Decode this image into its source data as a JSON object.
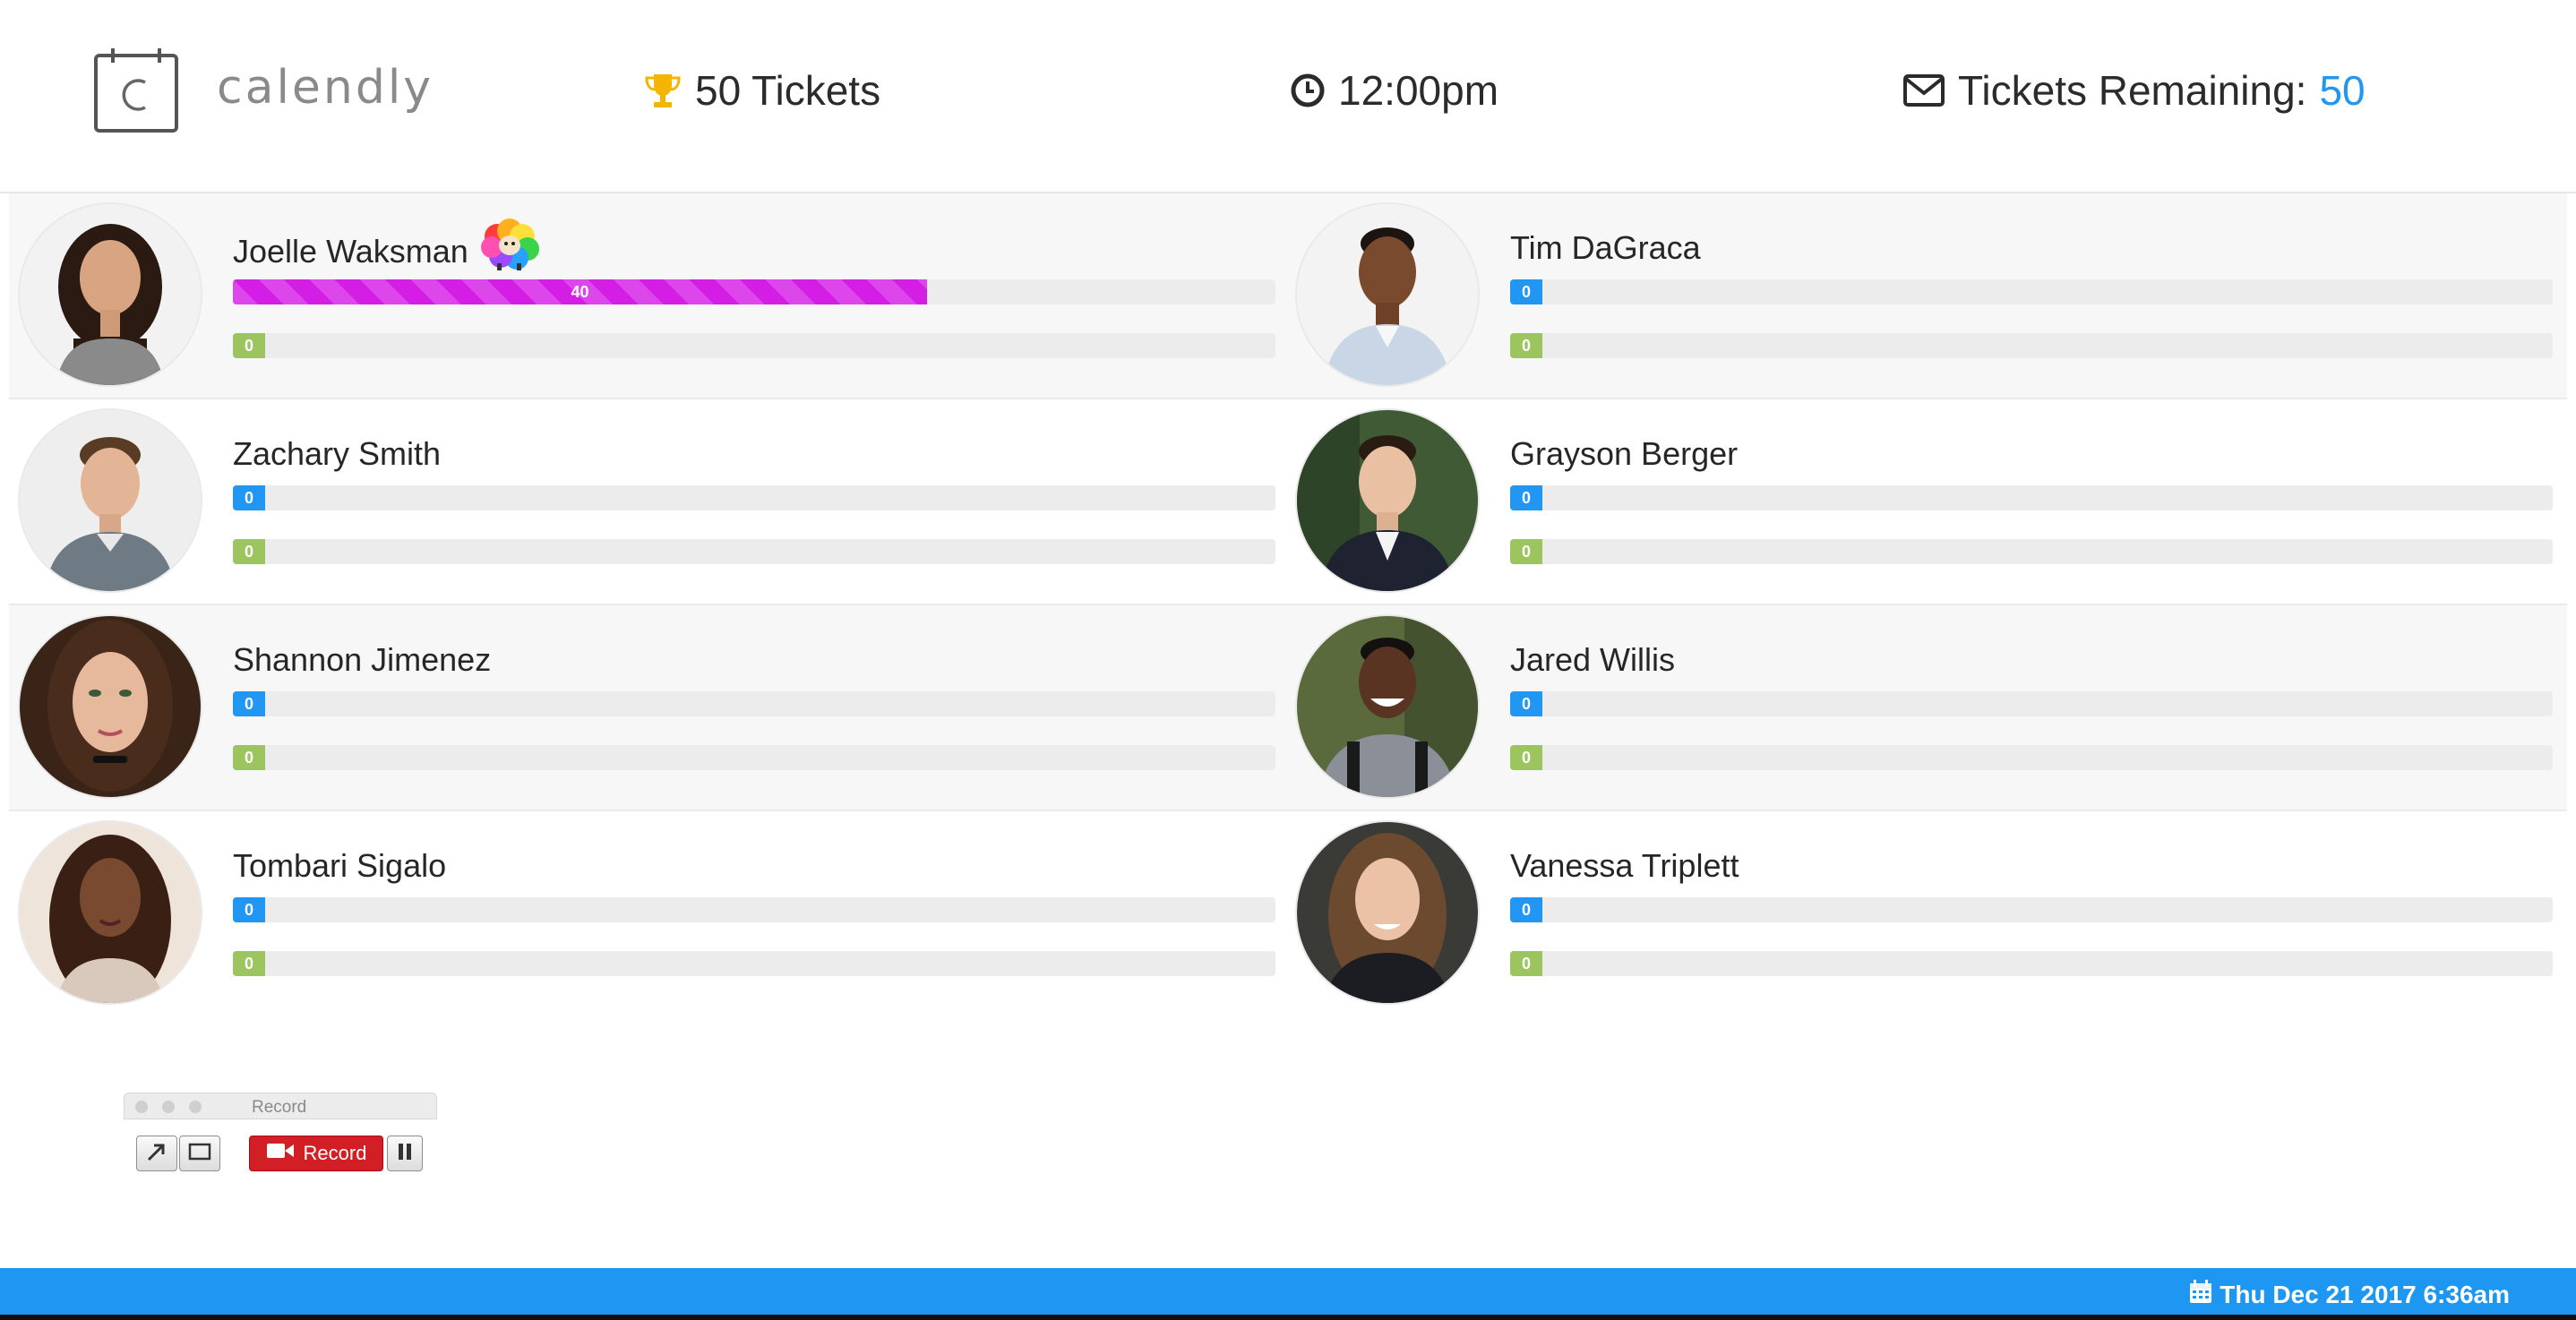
{
  "header": {
    "brand": "calendly",
    "tickets_label": "50 Tickets",
    "time_label": "12:00pm",
    "remaining_label": "Tickets Remaining:",
    "remaining_value": "50",
    "icons": [
      "calendar-logo-icon",
      "trophy-icon",
      "clock-icon",
      "envelope-icon"
    ],
    "colors": {
      "trophy": "#f5b400",
      "remaining": "#2196f3"
    }
  },
  "people": [
    {
      "name": "Joelle Waksman",
      "has_badge": true,
      "primary": {
        "label": "40",
        "fraction": 0.6656,
        "color": "#d41ee6",
        "striped": true
      },
      "secondary": {
        "label": "0",
        "fraction": 0,
        "color": "#9cc55f"
      }
    },
    {
      "name": "Tim DaGraca",
      "primary": {
        "label": "0",
        "fraction": 0,
        "color": "#2196f3"
      },
      "secondary": {
        "label": "0",
        "fraction": 0,
        "color": "#9cc55f"
      }
    },
    {
      "name": "Zachary Smith",
      "primary": {
        "label": "0",
        "fraction": 0,
        "color": "#2196f3"
      },
      "secondary": {
        "label": "0",
        "fraction": 0,
        "color": "#9cc55f"
      }
    },
    {
      "name": "Grayson Berger",
      "primary": {
        "label": "0",
        "fraction": 0,
        "color": "#2196f3"
      },
      "secondary": {
        "label": "0",
        "fraction": 0,
        "color": "#9cc55f"
      }
    },
    {
      "name": "Shannon Jimenez",
      "primary": {
        "label": "0",
        "fraction": 0,
        "color": "#2196f3"
      },
      "secondary": {
        "label": "0",
        "fraction": 0,
        "color": "#9cc55f"
      }
    },
    {
      "name": "Jared Willis",
      "primary": {
        "label": "0",
        "fraction": 0,
        "color": "#2196f3"
      },
      "secondary": {
        "label": "0",
        "fraction": 0,
        "color": "#9cc55f"
      }
    },
    {
      "name": "Tombari Sigalo",
      "primary": {
        "label": "0",
        "fraction": 0,
        "color": "#2196f3"
      },
      "secondary": {
        "label": "0",
        "fraction": 0,
        "color": "#9cc55f"
      }
    },
    {
      "name": "Vanessa Triplett",
      "primary": {
        "label": "0",
        "fraction": 0,
        "color": "#2196f3"
      },
      "secondary": {
        "label": "0",
        "fraction": 0,
        "color": "#9cc55f"
      }
    }
  ],
  "record_widget": {
    "title": "Record",
    "record_label": "Record",
    "icons": [
      "arrow-icon",
      "window-icon",
      "camera-icon",
      "pause-icon"
    ],
    "colors": {
      "record": "#d21f25"
    }
  },
  "footer": {
    "date": "Thu Dec 21 2017 6:36am",
    "icon": "calendar-icon",
    "colors": {
      "bar": "#1e97f3"
    }
  }
}
